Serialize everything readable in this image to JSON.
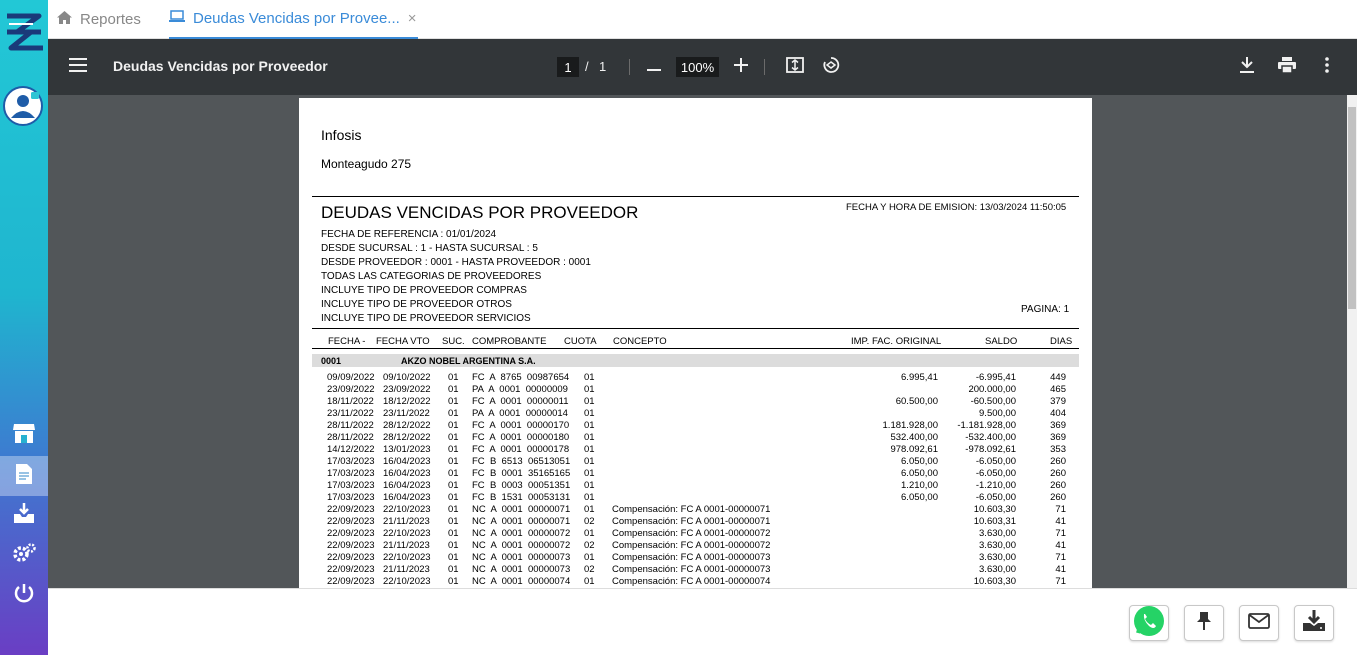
{
  "tabs": [
    {
      "label": "Reportes"
    },
    {
      "label": "Deudas Vencidas por Provee..."
    }
  ],
  "viewer": {
    "title": "Deudas Vencidas por Proveedor",
    "page_current": "1",
    "page_sep": "/",
    "page_total": "1",
    "zoom": "100%"
  },
  "report": {
    "company": "Infosis",
    "address": "Monteagudo 275",
    "title": "DEUDAS VENCIDAS POR PROVEEDOR",
    "emission": "FECHA Y HORA DE EMISION: 13/03/2024 11:50:05",
    "params": [
      "FECHA DE REFERENCIA : 01/01/2024",
      "DESDE SUCURSAL : 1 - HASTA SUCURSAL : 5",
      "DESDE PROVEEDOR : 0001 - HASTA PROVEEDOR : 0001",
      "TODAS LAS CATEGORIAS DE PROVEEDORES",
      "INCLUYE TIPO DE PROVEEDOR COMPRAS",
      "INCLUYE TIPO DE PROVEEDOR OTROS",
      "INCLUYE TIPO DE PROVEEDOR SERVICIOS"
    ],
    "page_label": "PAGINA: 1",
    "columns": {
      "fecha": "FECHA -",
      "fecha_vto": "FECHA VTO",
      "suc": "SUC.",
      "comprobante": "COMPROBANTE",
      "cuota": "CUOTA",
      "concepto": "CONCEPTO",
      "imp_original": "IMP. FAC. ORIGINAL",
      "saldo": "SALDO",
      "dias": "DIAS"
    },
    "group": {
      "code": "0001",
      "name": "AKZO NOBEL ARGENTINA S.A."
    },
    "rows": [
      {
        "fecha": "09/09/2022",
        "vto": "09/10/2022",
        "suc": "01",
        "comp": "FC  A  8765  00987654",
        "cuota": "01",
        "concepto": "",
        "original": "6.995,41",
        "saldo": "-6.995,41",
        "dias": "449"
      },
      {
        "fecha": "23/09/2022",
        "vto": "23/09/2022",
        "suc": "01",
        "comp": "PA  A  0001  00000009",
        "cuota": "01",
        "concepto": "",
        "original": "",
        "saldo": "200.000,00",
        "dias": "465"
      },
      {
        "fecha": "18/11/2022",
        "vto": "18/12/2022",
        "suc": "01",
        "comp": "FC  A  0001  00000011",
        "cuota": "01",
        "concepto": "",
        "original": "60.500,00",
        "saldo": "-60.500,00",
        "dias": "379"
      },
      {
        "fecha": "23/11/2022",
        "vto": "23/11/2022",
        "suc": "01",
        "comp": "PA  A  0001  00000014",
        "cuota": "01",
        "concepto": "",
        "original": "",
        "saldo": "9.500,00",
        "dias": "404"
      },
      {
        "fecha": "28/11/2022",
        "vto": "28/12/2022",
        "suc": "01",
        "comp": "FC  A  0001  00000170",
        "cuota": "01",
        "concepto": "",
        "original": "1.181.928,00",
        "saldo": "-1.181.928,00",
        "dias": "369"
      },
      {
        "fecha": "28/11/2022",
        "vto": "28/12/2022",
        "suc": "01",
        "comp": "FC  A  0001  00000180",
        "cuota": "01",
        "concepto": "",
        "original": "532.400,00",
        "saldo": "-532.400,00",
        "dias": "369"
      },
      {
        "fecha": "14/12/2022",
        "vto": "13/01/2023",
        "suc": "01",
        "comp": "FC  A  0001  00000178",
        "cuota": "01",
        "concepto": "",
        "original": "978.092,61",
        "saldo": "-978.092,61",
        "dias": "353"
      },
      {
        "fecha": "17/03/2023",
        "vto": "16/04/2023",
        "suc": "01",
        "comp": "FC  B  6513  06513051",
        "cuota": "01",
        "concepto": "",
        "original": "6.050,00",
        "saldo": "-6.050,00",
        "dias": "260"
      },
      {
        "fecha": "17/03/2023",
        "vto": "16/04/2023",
        "suc": "01",
        "comp": "FC  B  0001  35165165",
        "cuota": "01",
        "concepto": "",
        "original": "6.050,00",
        "saldo": "-6.050,00",
        "dias": "260"
      },
      {
        "fecha": "17/03/2023",
        "vto": "16/04/2023",
        "suc": "01",
        "comp": "FC  B  0003  00051351",
        "cuota": "01",
        "concepto": "",
        "original": "1.210,00",
        "saldo": "-1.210,00",
        "dias": "260"
      },
      {
        "fecha": "17/03/2023",
        "vto": "16/04/2023",
        "suc": "01",
        "comp": "FC  B  1531  00053131",
        "cuota": "01",
        "concepto": "",
        "original": "6.050,00",
        "saldo": "-6.050,00",
        "dias": "260"
      },
      {
        "fecha": "22/09/2023",
        "vto": "22/10/2023",
        "suc": "01",
        "comp": "NC  A  0001  00000071",
        "cuota": "01",
        "concepto": "Compensación: FC A 0001-00000071",
        "original": "",
        "saldo": "10.603,30",
        "dias": "71"
      },
      {
        "fecha": "22/09/2023",
        "vto": "21/11/2023",
        "suc": "01",
        "comp": "NC  A  0001  00000071",
        "cuota": "02",
        "concepto": "Compensación: FC A 0001-00000071",
        "original": "",
        "saldo": "10.603,31",
        "dias": "41"
      },
      {
        "fecha": "22/09/2023",
        "vto": "22/10/2023",
        "suc": "01",
        "comp": "NC  A  0001  00000072",
        "cuota": "01",
        "concepto": "Compensación: FC A 0001-00000072",
        "original": "",
        "saldo": "3.630,00",
        "dias": "71"
      },
      {
        "fecha": "22/09/2023",
        "vto": "21/11/2023",
        "suc": "01",
        "comp": "NC  A  0001  00000072",
        "cuota": "02",
        "concepto": "Compensación: FC A 0001-00000072",
        "original": "",
        "saldo": "3.630,00",
        "dias": "41"
      },
      {
        "fecha": "22/09/2023",
        "vto": "22/10/2023",
        "suc": "01",
        "comp": "NC  A  0001  00000073",
        "cuota": "01",
        "concepto": "Compensación: FC A 0001-00000073",
        "original": "",
        "saldo": "3.630,00",
        "dias": "71"
      },
      {
        "fecha": "22/09/2023",
        "vto": "21/11/2023",
        "suc": "01",
        "comp": "NC  A  0001  00000073",
        "cuota": "02",
        "concepto": "Compensación: FC A 0001-00000073",
        "original": "",
        "saldo": "3.630,00",
        "dias": "41"
      },
      {
        "fecha": "22/09/2023",
        "vto": "22/10/2023",
        "suc": "01",
        "comp": "NC  A  0001  00000074",
        "cuota": "01",
        "concepto": "Compensación: FC A 0001-00000074",
        "original": "",
        "saldo": "10.603,30",
        "dias": "71"
      }
    ]
  },
  "colors": {
    "accent": "#3a8bd8",
    "toolbar": "#323639",
    "viewer_bg": "#525659",
    "whatsapp": "#25d366"
  },
  "icons": [
    "home-icon",
    "laptop-icon",
    "close-icon",
    "menu-icon",
    "minus-icon",
    "plus-icon",
    "fit-page-icon",
    "rotate-icon",
    "download-icon",
    "print-icon",
    "more-vert-icon",
    "store-icon",
    "document-icon",
    "inbox-download-icon",
    "gears-icon",
    "power-icon",
    "whatsapp-icon",
    "pin-icon",
    "mail-icon",
    "save-download-icon"
  ]
}
